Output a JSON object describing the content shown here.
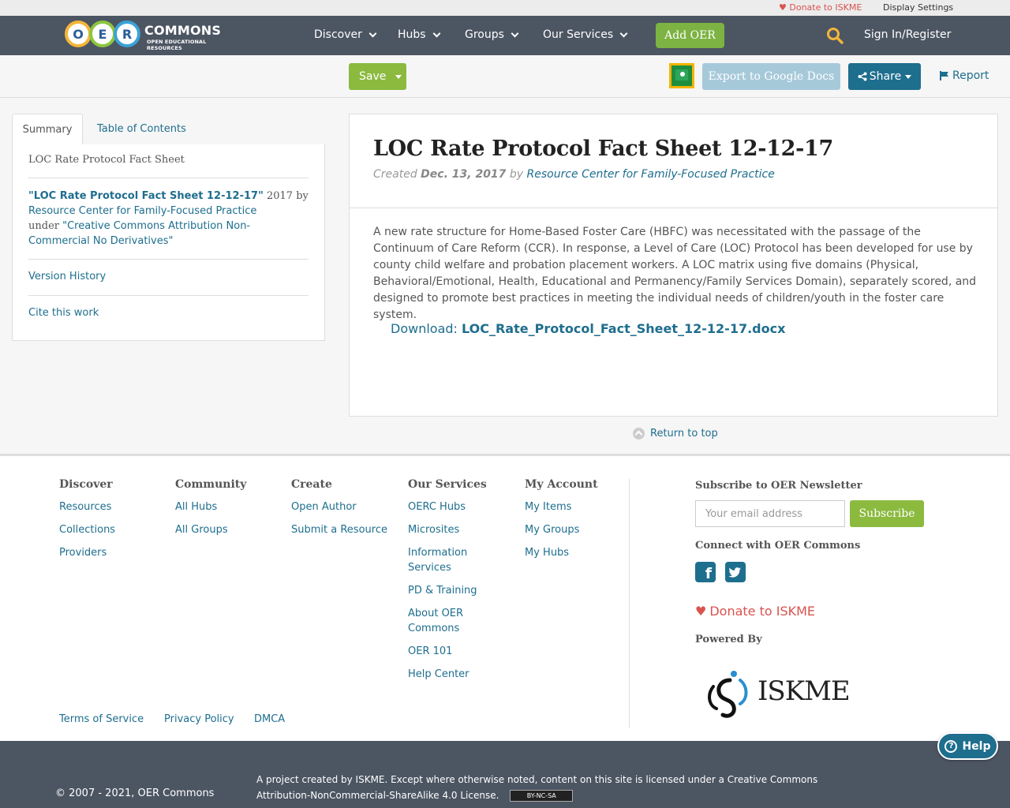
{
  "utility": {
    "donate": "Donate to ISKME",
    "display_settings": "Display Settings"
  },
  "brand": {
    "letters": [
      "O",
      "E",
      "R"
    ],
    "name": "COMMONS",
    "tagline": "OPEN EDUCATIONAL RESOURCES"
  },
  "nav": {
    "items": [
      "Discover",
      "Hubs",
      "Groups",
      "Our Services"
    ],
    "add_oer": "Add OER",
    "sign_in": "Sign In/Register"
  },
  "toolbar": {
    "save": "Save",
    "export": "Export to Google Docs",
    "share": "Share",
    "report": "Report"
  },
  "sidebar": {
    "tabs": [
      "Summary",
      "Table of Contents"
    ],
    "title": "LOC Rate Protocol Fact Sheet",
    "attribution": {
      "work": "\"LOC Rate Protocol Fact Sheet 12-12-17\"",
      "year_by": " 2017 by",
      "author": "Resource Center for Family-Focused Practice",
      "under": "under ",
      "license": "\"Creative Commons Attribution Non-Commercial No Derivatives\""
    },
    "version_history": "Version History",
    "cite": "Cite this work"
  },
  "resource": {
    "title": "LOC Rate Protocol Fact Sheet 12-12-17",
    "created_label": "Created ",
    "date": "Dec. 13, 2017",
    "by_label": " by ",
    "author": "Resource Center for Family-Focused Practice",
    "description": "A new rate structure for Home-Based Foster Care (HBFC) was necessitated with the passage of the Continuum of Care Reform (CCR). In response, a Level of Care (LOC) Protocol has been developed for use by county child welfare and probation placement workers. A LOC matrix using five domains (Physical, Behavioral/Emotional, Health, Educational and Permanency/Family Services Domain), separately scored, and designed to promote best practices in meeting the individual needs of children/youth in the foster care system.",
    "download_label": "Download: ",
    "download_file": "LOC_Rate_Protocol_Fact_Sheet_12-12-17.docx"
  },
  "return_top": "Return to top",
  "footer": {
    "columns": [
      {
        "heading": "Discover",
        "links": [
          "Resources",
          "Collections",
          "Providers"
        ]
      },
      {
        "heading": "Community",
        "links": [
          "All Hubs",
          "All Groups"
        ]
      },
      {
        "heading": "Create",
        "links": [
          "Open Author",
          "Submit a Resource"
        ]
      },
      {
        "heading": "Our Services",
        "links": [
          "OERC Hubs",
          "Microsites",
          "Information Services",
          "PD & Training",
          "About OER Commons",
          "OER 101",
          "Help Center"
        ]
      },
      {
        "heading": "My Account",
        "links": [
          "My Items",
          "My Groups",
          "My Hubs"
        ]
      }
    ],
    "newsletter_heading": "Subscribe to OER Newsletter",
    "email_placeholder": "Your email address",
    "subscribe": "Subscribe",
    "connect_heading": "Connect with OER Commons",
    "donate": "Donate to ISKME",
    "powered_by": "Powered By",
    "iskme": "ISKME",
    "legal": [
      "Terms of Service",
      "Privacy Policy",
      "DMCA"
    ]
  },
  "bottom": {
    "copyright": "© 2007 - 2021, OER Commons",
    "license": "A project created by ISKME. Except where otherwise noted, content on this site is licensed under a Creative Commons Attribution-NonCommercial-ShareAlike 4.0 License.",
    "cc_badge": "BY-NC-SA"
  },
  "help": "Help",
  "colors": {
    "nav_bg": "#4c5562",
    "accent_green": "#8bba3f",
    "link_blue": "#1e6e8e",
    "donate_red": "#d9534f"
  }
}
